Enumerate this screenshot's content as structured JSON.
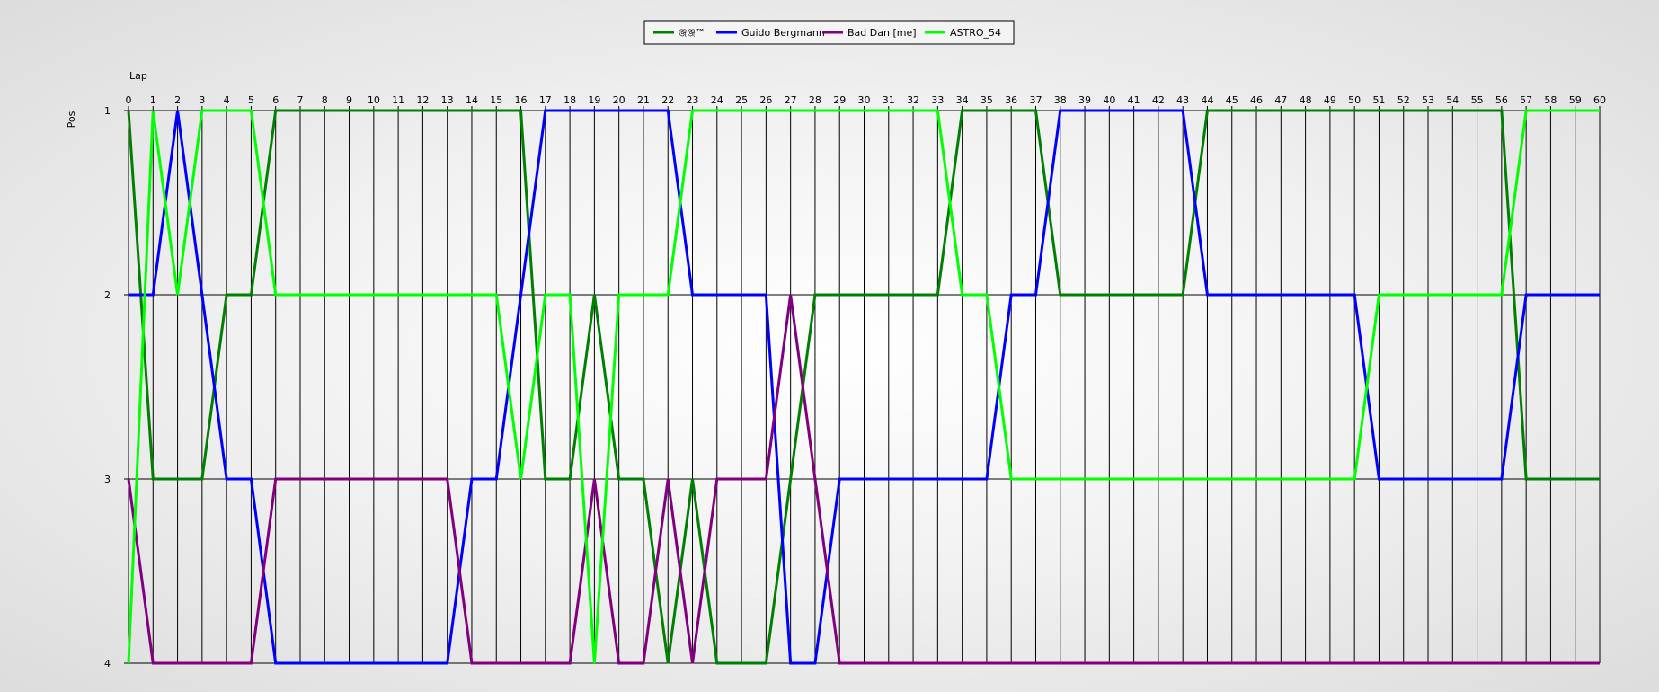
{
  "chart_data": {
    "type": "line",
    "xlabel": "Lap",
    "ylabel": "Pos",
    "xlim": [
      0,
      60
    ],
    "ylim": [
      1,
      4
    ],
    "y_inverted": true,
    "x_ticks": [
      0,
      1,
      2,
      3,
      4,
      5,
      6,
      7,
      8,
      9,
      10,
      11,
      12,
      13,
      14,
      15,
      16,
      17,
      18,
      19,
      20,
      21,
      22,
      23,
      24,
      25,
      26,
      27,
      28,
      29,
      30,
      31,
      32,
      33,
      34,
      35,
      36,
      37,
      38,
      39,
      40,
      41,
      42,
      43,
      44,
      45,
      46,
      47,
      48,
      49,
      50,
      51,
      52,
      53,
      54,
      55,
      56,
      57,
      58,
      59,
      60
    ],
    "y_ticks": [
      1,
      2,
      3,
      4
    ],
    "grid": true,
    "legend_position": "top-center",
    "series": [
      {
        "name": "ঞ্জঞ্জ™",
        "color": "#008000",
        "values": [
          1,
          3,
          3,
          3,
          2,
          2,
          1,
          1,
          1,
          1,
          1,
          1,
          1,
          1,
          1,
          1,
          1,
          3,
          3,
          2,
          3,
          3,
          4,
          3,
          4,
          4,
          4,
          3,
          2,
          2,
          2,
          2,
          2,
          2,
          1,
          1,
          1,
          1,
          2,
          2,
          2,
          2,
          2,
          2,
          1,
          1,
          1,
          1,
          1,
          1,
          1,
          1,
          1,
          1,
          1,
          1,
          1,
          3,
          3,
          3,
          3
        ]
      },
      {
        "name": "Guido Bergmann",
        "color": "#0000ff",
        "values": [
          2,
          2,
          1,
          2,
          3,
          3,
          4,
          4,
          4,
          4,
          4,
          4,
          4,
          4,
          3,
          3,
          2,
          1,
          1,
          1,
          1,
          1,
          1,
          2,
          2,
          2,
          2,
          4,
          4,
          3,
          3,
          3,
          3,
          3,
          3,
          3,
          2,
          2,
          1,
          1,
          1,
          1,
          1,
          1,
          2,
          2,
          2,
          2,
          2,
          2,
          2,
          3,
          3,
          3,
          3,
          3,
          3,
          2,
          2,
          2,
          2
        ]
      },
      {
        "name": "Bad Dan [me]",
        "color": "#800080",
        "values": [
          3,
          4,
          4,
          4,
          4,
          4,
          3,
          3,
          3,
          3,
          3,
          3,
          3,
          3,
          4,
          4,
          4,
          4,
          4,
          3,
          4,
          4,
          3,
          4,
          3,
          3,
          3,
          2,
          3,
          4,
          4,
          4,
          4,
          4,
          4,
          4,
          4,
          4,
          4,
          4,
          4,
          4,
          4,
          4,
          4,
          4,
          4,
          4,
          4,
          4,
          4,
          4,
          4,
          4,
          4,
          4,
          4,
          4,
          4,
          4,
          4
        ]
      },
      {
        "name": "ASTRO_54",
        "color": "#00ff00",
        "values": [
          4,
          1,
          2,
          1,
          1,
          1,
          2,
          2,
          2,
          2,
          2,
          2,
          2,
          2,
          2,
          2,
          3,
          2,
          2,
          4,
          2,
          2,
          2,
          1,
          1,
          1,
          1,
          1,
          1,
          1,
          1,
          1,
          1,
          1,
          2,
          2,
          3,
          3,
          3,
          3,
          3,
          3,
          3,
          3,
          3,
          3,
          3,
          3,
          3,
          3,
          3,
          2,
          2,
          2,
          2,
          2,
          2,
          1,
          1,
          1,
          1
        ]
      }
    ]
  }
}
